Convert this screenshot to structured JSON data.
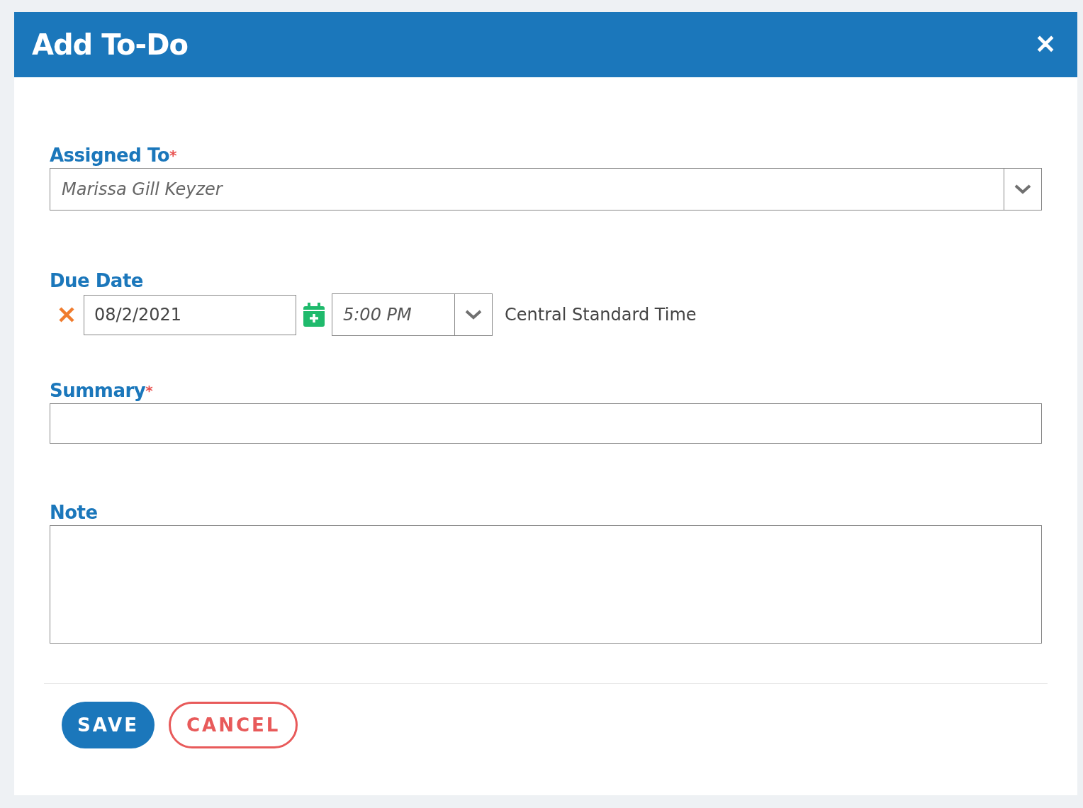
{
  "dialog": {
    "title": "Add To-Do",
    "close": "✕"
  },
  "assigned_to": {
    "label": "Assigned To",
    "required_mark": "*",
    "value": "Marissa Gill Keyzer"
  },
  "due_date": {
    "label": "Due Date",
    "date": "08/2/2021",
    "time": "5:00 PM",
    "timezone": "Central Standard Time"
  },
  "summary": {
    "label": "Summary",
    "required_mark": "*"
  },
  "note": {
    "label": "Note"
  },
  "buttons": [
    {
      "label": "SAVE",
      "kind": "primary"
    },
    {
      "label": "CANCEL",
      "kind": "outline"
    }
  ]
}
